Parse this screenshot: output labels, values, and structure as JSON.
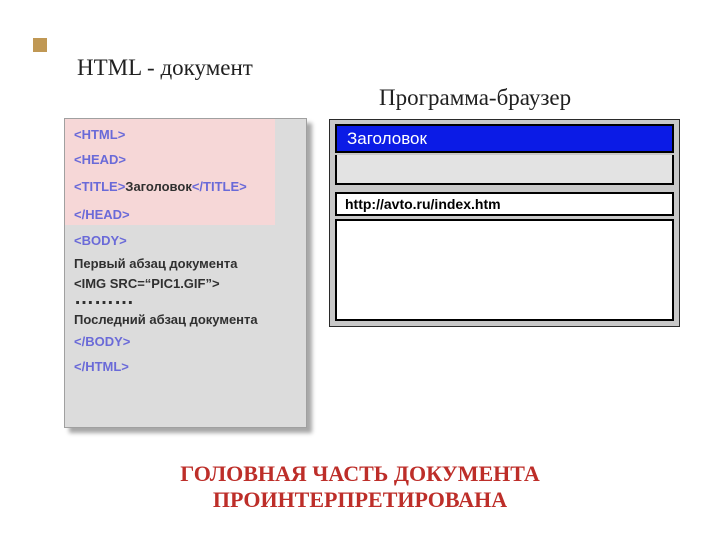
{
  "headings": {
    "document": "HTML - документ",
    "browser": "Программа-браузер"
  },
  "code": {
    "html_open": "<HTML>",
    "head_open": "<HEAD>",
    "title_open": "<TITLE>",
    "title_text": "Заголовок",
    "title_close": "</TITLE>",
    "head_close": "</HEAD>",
    "body_open": "<BODY>",
    "first_para": "Первый абзац документа",
    "img_tag": "<IMG SRC=“PIC1.GIF”>",
    "dots": "………",
    "last_para": "Последний абзац документа",
    "body_close": "</BODY>",
    "html_close": "</HTML>"
  },
  "browser": {
    "title": "Заголовок",
    "address": "http://avto.ru/index.htm"
  },
  "caption": {
    "line1": "ГОЛОВНАЯ ЧАСТЬ ДОКУМЕНТА",
    "line2": "ПРОИНТЕРПРЕТИРОВАНА"
  }
}
